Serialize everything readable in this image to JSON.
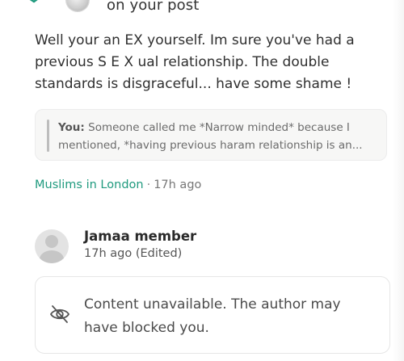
{
  "notification": {
    "text": "on your post",
    "icons": [
      "check-icon",
      "avatar"
    ]
  },
  "comment": {
    "body": "Well your an EX yourself. Im sure you've had a previous S E X ual relationship.  The double standards is disgraceful... have some shame !"
  },
  "quote": {
    "author": "You:",
    "text": "Someone called me *Narrow minded* because I mentioned, *having previous haram relationship is an..."
  },
  "meta": {
    "community": "Muslims in London",
    "separator": "·",
    "time": "17h ago"
  },
  "member": {
    "name": "Jamaa member",
    "meta": "17h ago (Edited)"
  },
  "unavailable": {
    "message": "Content unavailable. The author may have blocked you.",
    "icon": "eye-off-icon"
  },
  "colors": {
    "accent": "#1f9a7e",
    "quote_bg": "#f7f7f6",
    "text": "#2f2f2f",
    "muted": "#6b6b6b"
  }
}
